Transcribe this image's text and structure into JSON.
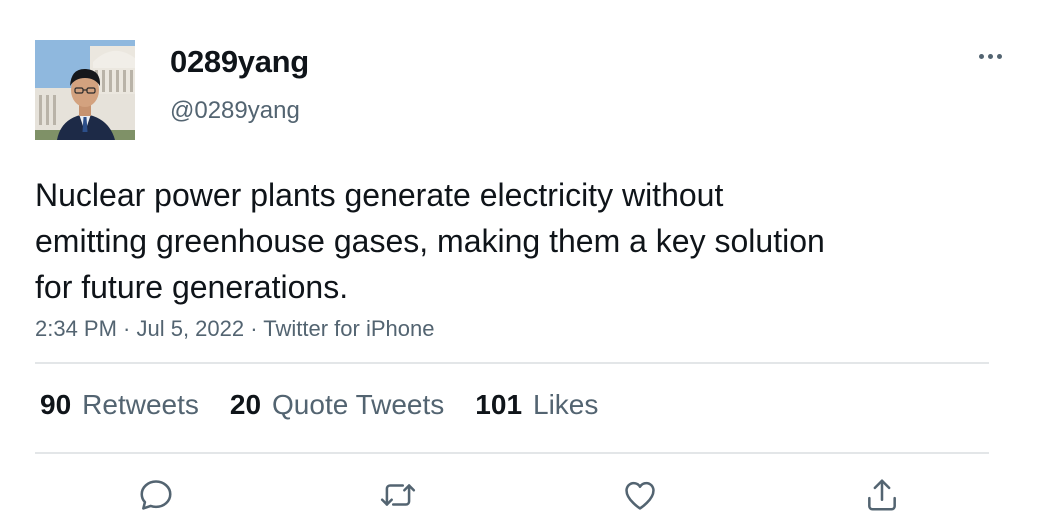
{
  "user": {
    "display_name": "0289yang",
    "handle": "@0289yang"
  },
  "tweet": {
    "text_lines": [
      "Nuclear power plants generate electricity without",
      "emitting greenhouse gases, making them a key solution",
      "for future generations."
    ],
    "meta": "2:34 PM · Jul 5, 2022 · Twitter for iPhone"
  },
  "stats": {
    "retweets": {
      "count": "90",
      "label": "Retweets"
    },
    "quote_tweets": {
      "count": "20",
      "label": "Quote Tweets"
    },
    "likes": {
      "count": "101",
      "label": "Likes"
    }
  },
  "actions": [
    "reply-icon",
    "retweet-icon",
    "like-icon",
    "share-icon"
  ],
  "colors": {
    "text": "#0f1419",
    "secondary": "#536471",
    "divider": "#e3e6e8"
  }
}
